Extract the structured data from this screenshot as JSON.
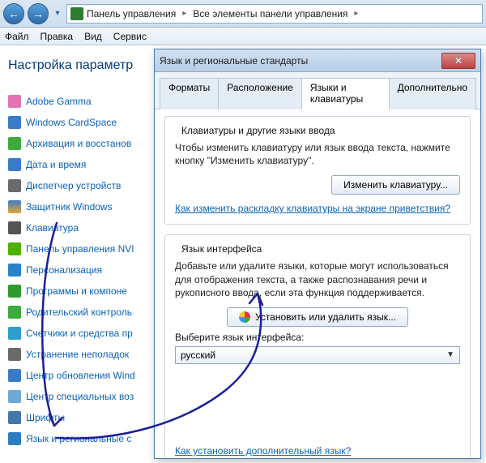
{
  "address": {
    "crumb1": "Панель управления",
    "crumb2": "Все элементы панели управления"
  },
  "menu": {
    "file": "Файл",
    "edit": "Правка",
    "view": "Вид",
    "service": "Сервис"
  },
  "page": {
    "title": "Настройка параметр"
  },
  "sidebar": {
    "items": [
      {
        "label": "Adobe Gamma"
      },
      {
        "label": "Windows CardSpace"
      },
      {
        "label": "Архивация и восстанов"
      },
      {
        "label": "Дата и время"
      },
      {
        "label": "Диспетчер устройств"
      },
      {
        "label": "Защитник Windows"
      },
      {
        "label": "Клавиатура"
      },
      {
        "label": "Панель управления NVI"
      },
      {
        "label": "Персонализация"
      },
      {
        "label": "Программы и компоне"
      },
      {
        "label": "Родительский контроль"
      },
      {
        "label": "Счетчики и средства пр"
      },
      {
        "label": "Устранение неполадок"
      },
      {
        "label": "Центр обновления Wind"
      },
      {
        "label": "Центр специальных воз"
      },
      {
        "label": "Шрифты"
      },
      {
        "label": "Язык и региональные с"
      }
    ]
  },
  "dialog": {
    "title": "Язык и региональные стандарты",
    "tabs": [
      "Форматы",
      "Расположение",
      "Языки и клавиатуры",
      "Дополнительно"
    ],
    "active_tab": 2,
    "kb_section": {
      "heading": "Клавиатуры и другие языки ввода",
      "desc": "Чтобы изменить клавиатуру или язык ввода текста, нажмите кнопку \"Изменить клавиатуру\".",
      "button": "Изменить клавиатуру...",
      "link": "Как изменить раскладку клавиатуры на экране приветствия?"
    },
    "ui_section": {
      "heading": "Язык интерфейса",
      "desc": "Добавьте или удалите языки, которые могут использоваться для отображения текста, а также распознавания речи и рукописного ввода, если эта функция поддерживается.",
      "button": "Установить или удалить язык...",
      "select_label": "Выберите язык интерфейса:",
      "select_value": "русский",
      "link": "Как установить дополнительный язык?"
    }
  }
}
